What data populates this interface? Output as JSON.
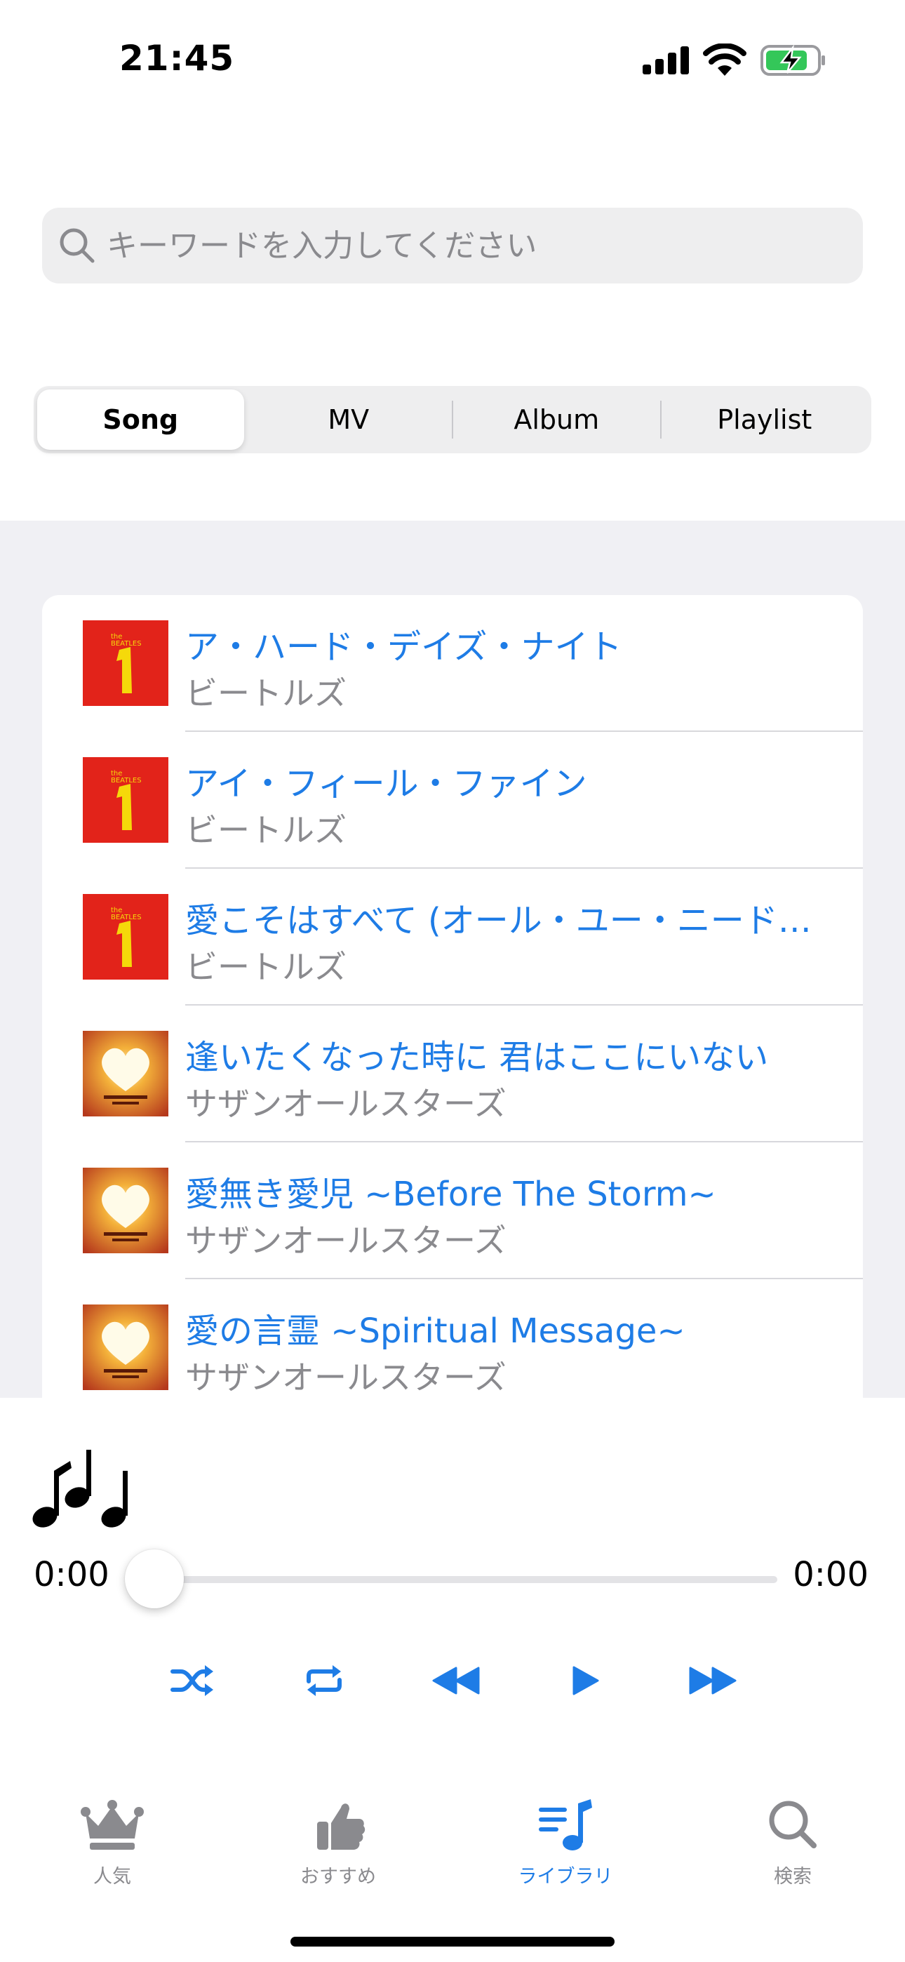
{
  "status_bar": {
    "time": "21:45"
  },
  "search": {
    "placeholder": "キーワードを入力してください",
    "value": ""
  },
  "segments": [
    "Song",
    "MV",
    "Album",
    "Playlist"
  ],
  "selected_segment": "Song",
  "songs": [
    {
      "title": "ア・ハード・デイズ・ナイト",
      "artist": "ビートルズ",
      "artwork": "beatles-1-album-art"
    },
    {
      "title": "アイ・フィール・ファイン",
      "artist": "ビートルズ",
      "artwork": "beatles-1-album-art"
    },
    {
      "title": "愛こそはすべて (オール・ユー・ニード…",
      "artist": "ビートルズ",
      "artwork": "beatles-1-album-art"
    },
    {
      "title": "逢いたくなった時に 君はここにいない",
      "artist": "サザンオールスターズ",
      "artwork": "sunset-heart-album-art"
    },
    {
      "title": "愛無き愛児 ~Before The Storm~",
      "artist": "サザンオールスターズ",
      "artwork": "sunset-heart-album-art"
    },
    {
      "title": "愛の言霊 ~Spiritual Message~",
      "artist": "サザンオールスターズ",
      "artwork": "sunset-heart-album-art"
    }
  ],
  "player": {
    "current_time": "0:00",
    "total_time": "0:00",
    "progress": 0,
    "controls": [
      "shuffle-icon",
      "repeat-icon",
      "rewind-icon",
      "play-icon",
      "fast-forward-icon"
    ]
  },
  "tabs": [
    {
      "label": "人気",
      "icon": "crown-icon",
      "active": false
    },
    {
      "label": "おすすめ",
      "icon": "thumbs-up-icon",
      "active": false
    },
    {
      "label": "ライブラリ",
      "icon": "music-library-icon",
      "active": true
    },
    {
      "label": "検索",
      "icon": "search-icon",
      "active": false
    }
  ],
  "colors": {
    "accent": "#1e7ce6",
    "secondary_text": "#8a8a8e",
    "list_background": "#f0f0f4"
  }
}
